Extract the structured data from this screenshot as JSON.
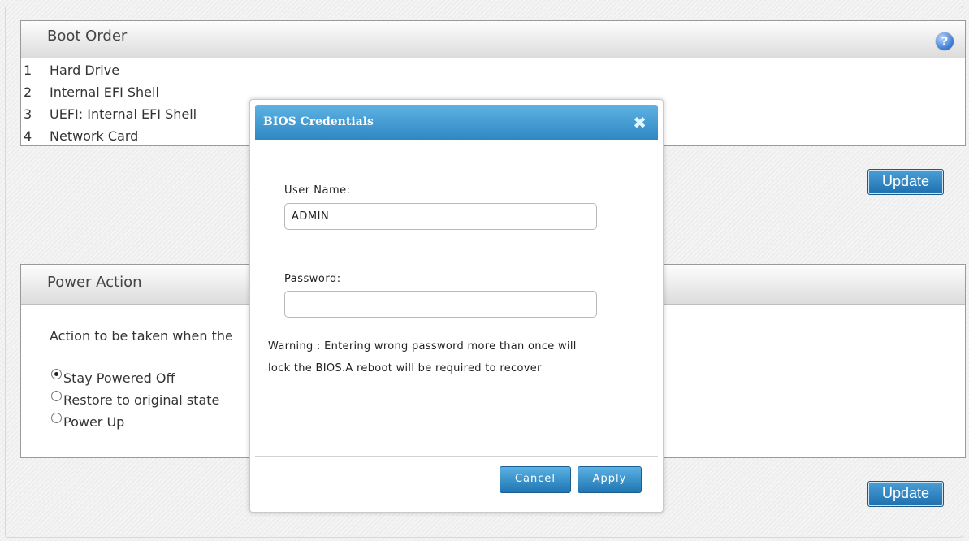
{
  "boot_order": {
    "title": "Boot Order",
    "items": [
      {
        "num": "1",
        "name": "Hard Drive"
      },
      {
        "num": "2",
        "name": "Internal EFI Shell"
      },
      {
        "num": "3",
        "name": "UEFI: Internal EFI Shell"
      },
      {
        "num": "4",
        "name": "Network Card"
      }
    ],
    "help_icon": "question-circle-icon",
    "help_glyph": "?",
    "update_label": "Update"
  },
  "power_action": {
    "title": "Power Action",
    "description": "Action to be taken when the",
    "options": [
      {
        "label": "Stay Powered Off",
        "checked": true
      },
      {
        "label": "Restore to original state",
        "checked": false
      },
      {
        "label": "Power Up",
        "checked": false
      }
    ],
    "update_label": "Update"
  },
  "modal": {
    "title": "BIOS Credentials",
    "close_glyph": "✖",
    "username_label": "User Name:",
    "username_value": "ADMIN",
    "password_label": "Password:",
    "password_value": "",
    "warning_line1": "Warning : Entering wrong password more than once will",
    "warning_line2": "lock the BIOS.A reboot will be required to recover",
    "cancel_label": "Cancel",
    "apply_label": "Apply"
  },
  "colors": {
    "accent": "#2d88c2",
    "button_blue": "#1f6fae"
  }
}
